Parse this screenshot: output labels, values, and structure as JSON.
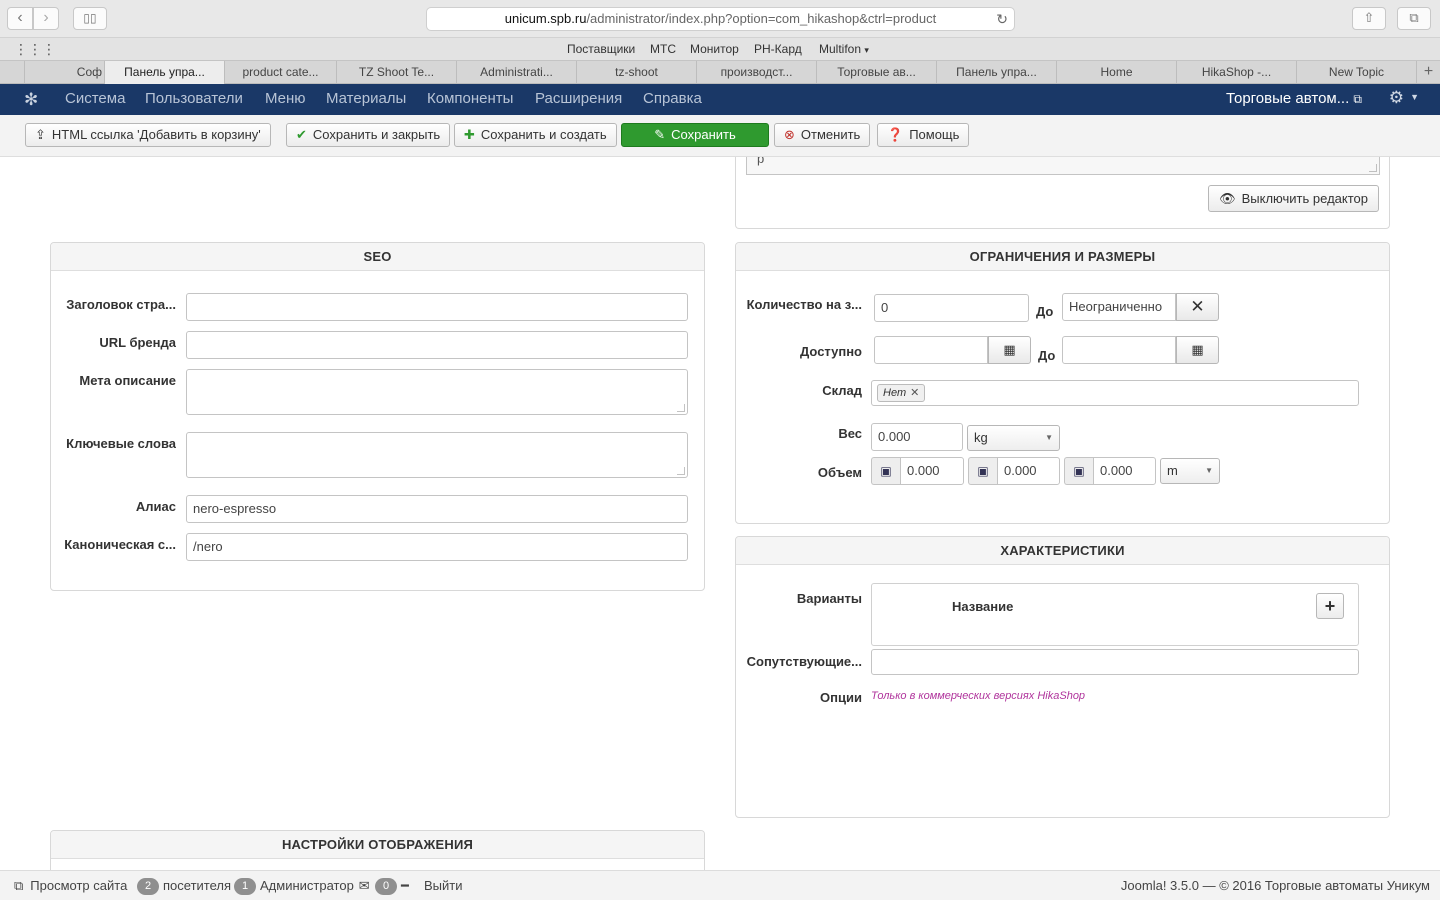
{
  "browser": {
    "url_host": "unicum.spb.ru",
    "url_path": "/administrator/index.php?option=com_hikashop&ctrl=product",
    "bookmarks": [
      "Поставщики",
      "МТС",
      "Монитор",
      "РН-Кард",
      "Multifon"
    ],
    "tabs": [
      "Соф",
      "Панель упра...",
      "product cate...",
      "TZ Shoot Te...",
      "Administrati...",
      "tz-shoot",
      "производст...",
      "Торговые ав...",
      "Панель упра...",
      "Home",
      "HikaShop -...",
      "New Topic"
    ],
    "icons": {
      "back": "chevron-left-icon",
      "forward": "chevron-right-icon",
      "sidebar": "sidebar-icon",
      "reload": "reload-icon",
      "share": "share-icon",
      "tabs": "tabs-overview-icon",
      "apps": "apps-grid-icon",
      "new_tab": "plus-icon"
    }
  },
  "navbar": {
    "menu": [
      "Система",
      "Пользователи",
      "Меню",
      "Материалы",
      "Компоненты",
      "Расширения",
      "Справка"
    ],
    "site_name": "Торговые автом...",
    "bg_color": "#1a3867"
  },
  "toolbar": {
    "html_link": "HTML ссылка 'Добавить в корзину'",
    "save_close": "Сохранить и закрыть",
    "save_new": "Сохранить и создать",
    "save": "Сохранить",
    "cancel": "Отменить",
    "help": "Помощь",
    "success_color": "#2f9a2f"
  },
  "editor": {
    "content_char": "p",
    "toggle_label": "Выключить редактор"
  },
  "seo": {
    "title": "SEO",
    "fields": {
      "page_title": {
        "label": "Заголовок стра...",
        "value": ""
      },
      "brand_url": {
        "label": "URL бренда",
        "value": ""
      },
      "meta_description": {
        "label": "Мета описание",
        "value": ""
      },
      "keywords": {
        "label": "Ключевые слова",
        "value": ""
      },
      "alias": {
        "label": "Алиас",
        "value": "nero-espresso"
      },
      "canonical": {
        "label": "Каноническая с...",
        "value": "/nero"
      }
    }
  },
  "limits": {
    "title": "ОГРАНИЧЕНИЯ И РАЗМЕРЫ",
    "quantity": {
      "label": "Количество на з...",
      "min": "0",
      "to_label": "До",
      "max": "Неограниченно"
    },
    "available": {
      "label": "Доступно",
      "from": "",
      "to_label": "До",
      "to": ""
    },
    "warehouse": {
      "label": "Склад",
      "tag": "Нет"
    },
    "weight": {
      "label": "Вес",
      "value": "0.000",
      "unit": "kg"
    },
    "volume": {
      "label": "Объем",
      "length": "0.000",
      "width": "0.000",
      "height": "0.000",
      "unit": "m"
    }
  },
  "characteristics": {
    "title": "ХАРАКТЕРИСТИКИ",
    "variants_label": "Варианты",
    "variants_column": "Название",
    "related_label": "Сопутствующие...",
    "options_label": "Опции",
    "options_note": "Только в коммерческих версиях HikaShop",
    "note_color": "#b0349c"
  },
  "display": {
    "title": "НАСТРОЙКИ ОТОБРАЖЕНИЯ"
  },
  "statusbar": {
    "view_site": "Просмотр сайта",
    "visitors_count": "2",
    "visitors_label": "посетителя",
    "admins_count": "1",
    "admins_label": "Администратор",
    "messages_count": "0",
    "logout": "Выйти",
    "footer": "Joomla! 3.5.0 — © 2016 Торговые автоматы Уникум"
  }
}
